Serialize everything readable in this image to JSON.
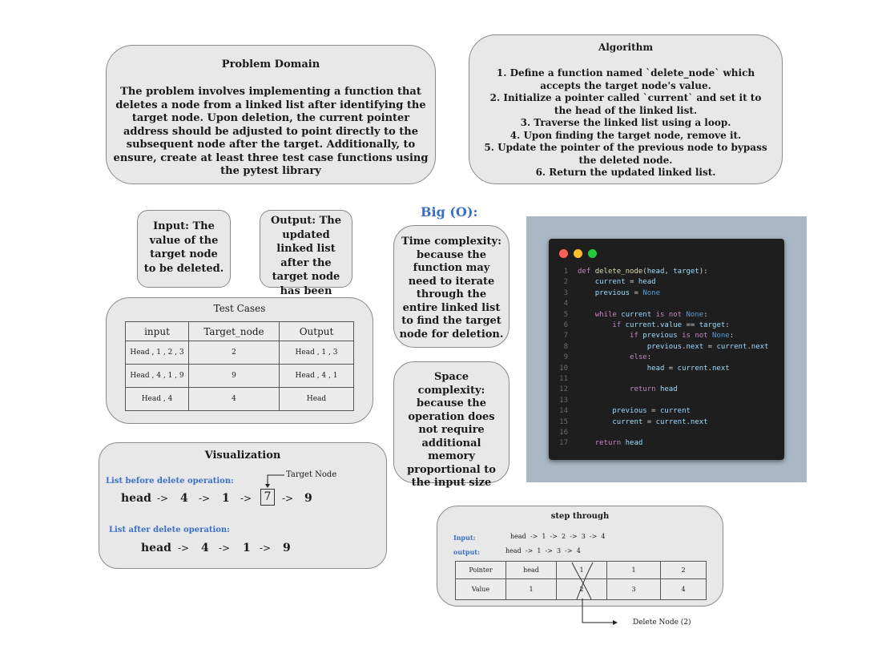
{
  "problem_domain": {
    "title": "Problem Domain",
    "text": "The problem involves implementing a function that deletes a node from a linked list after identifying the target node. Upon deletion, the current pointer address should be adjusted to point directly to the subsequent node after the target. Additionally, to ensure, create at least three test case functions using the pytest library"
  },
  "algorithm": {
    "title": "Algorithm",
    "steps": [
      "1. Define a function named `delete_node` which accepts the target node's value.",
      "2. Initialize a pointer called `current` and set it to the head of the linked list.",
      "3. Traverse the linked list using a loop.",
      "4. Upon finding the target node, remove it.",
      "5. Update the pointer of the previous node to bypass the deleted node.",
      "6. Return the updated linked list."
    ]
  },
  "input_box": "Input: The value of the target node to be deleted.",
  "output_box": "Output: The updated linked list after the target node has been removed.",
  "big_o": {
    "title": "Big (O):",
    "time": "Time complexity: because the function may need to iterate through the entire linked list to find the target node for deletion.",
    "space": "Space complexity: because the operation does not require additional memory proportional to the input size"
  },
  "test_cases": {
    "title": "Test Cases",
    "headers": [
      "input",
      "Target_node",
      "Output"
    ],
    "rows": [
      [
        "Head , 1 , 2 , 3",
        "2",
        "Head , 1 , 3"
      ],
      [
        "Head , 4 , 1 , 9",
        "9",
        "Head , 4 , 1"
      ],
      [
        "Head , 4",
        "4",
        "Head"
      ]
    ]
  },
  "visualization": {
    "title": "Visualization",
    "target_label": "Target Node",
    "before_label": "List before delete operation:",
    "after_label": "List after delete operation:",
    "before": [
      "head",
      "4",
      "1",
      "7",
      "9"
    ],
    "after": [
      "head",
      "4",
      "1",
      "9"
    ],
    "arrow": "->"
  },
  "code": {
    "lines": [
      "def delete_node(head, target):",
      "    current = head",
      "    previous = None",
      "",
      "    while current is not None:",
      "        if current.value == target:",
      "            if previous is not None:",
      "                previous.next = current.next",
      "            else:",
      "                head = current.next",
      "",
      "            return head",
      "",
      "        previous = current",
      "        current = current.next",
      "",
      "    return head"
    ],
    "colors": {
      "red": "#ff5f56",
      "yellow": "#ffbd2e",
      "green": "#27c93f"
    }
  },
  "step_through": {
    "title": "step through",
    "input_label": "Input:",
    "input_value": "head  ->  1  ->  2  ->  3  ->  4",
    "output_label": "output:",
    "output_value": "head  ->  1  ->  3  ->  4",
    "rows": [
      [
        "Pointer",
        "head",
        "1",
        "1",
        "2"
      ],
      [
        "Value",
        "1",
        "2",
        "3",
        "4"
      ]
    ],
    "delete_label": "Delete Node (2)"
  }
}
